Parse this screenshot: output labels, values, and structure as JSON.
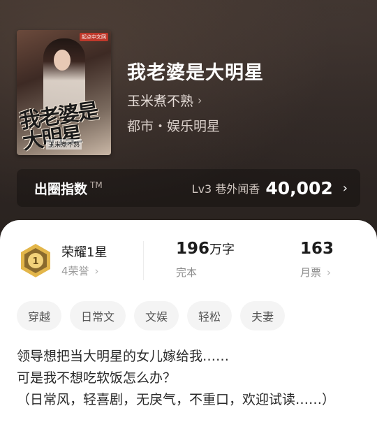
{
  "book": {
    "cover_title": "我老婆是大明星",
    "cover_author": "玉米煮不熟",
    "cover_logo": "起点中文网",
    "title": "我老婆是大明星",
    "author": "玉米煮不熟",
    "genre": "都市・娱乐明星"
  },
  "index": {
    "label": "出圈指数",
    "tm": "TM",
    "level": "Lv3 巷外闻香",
    "score": "40,002"
  },
  "stats": {
    "honor_title": "荣耀1星",
    "honor_sub": "4荣誉",
    "words_num": "196",
    "words_unit": "万字",
    "words_label": "完本",
    "votes_num": "163",
    "votes_label": "月票"
  },
  "tags": [
    "穿越",
    "日常文",
    "文娱",
    "轻松",
    "夫妻"
  ],
  "intro": {
    "line1": "领导想把当大明星的女儿嫁给我……",
    "line2": "可是我不想吃软饭怎么办？",
    "line3": "（日常风，轻喜剧，无戾气，不重口，欢迎试读……）"
  },
  "colors": {
    "hero_bg": "#2f2724",
    "medal_gold": "#d9a93a",
    "text_dark": "#1c1c1c",
    "tag_bg": "#f4f4f4"
  },
  "icons": [
    "chevron-right-icon",
    "medal-icon"
  ]
}
